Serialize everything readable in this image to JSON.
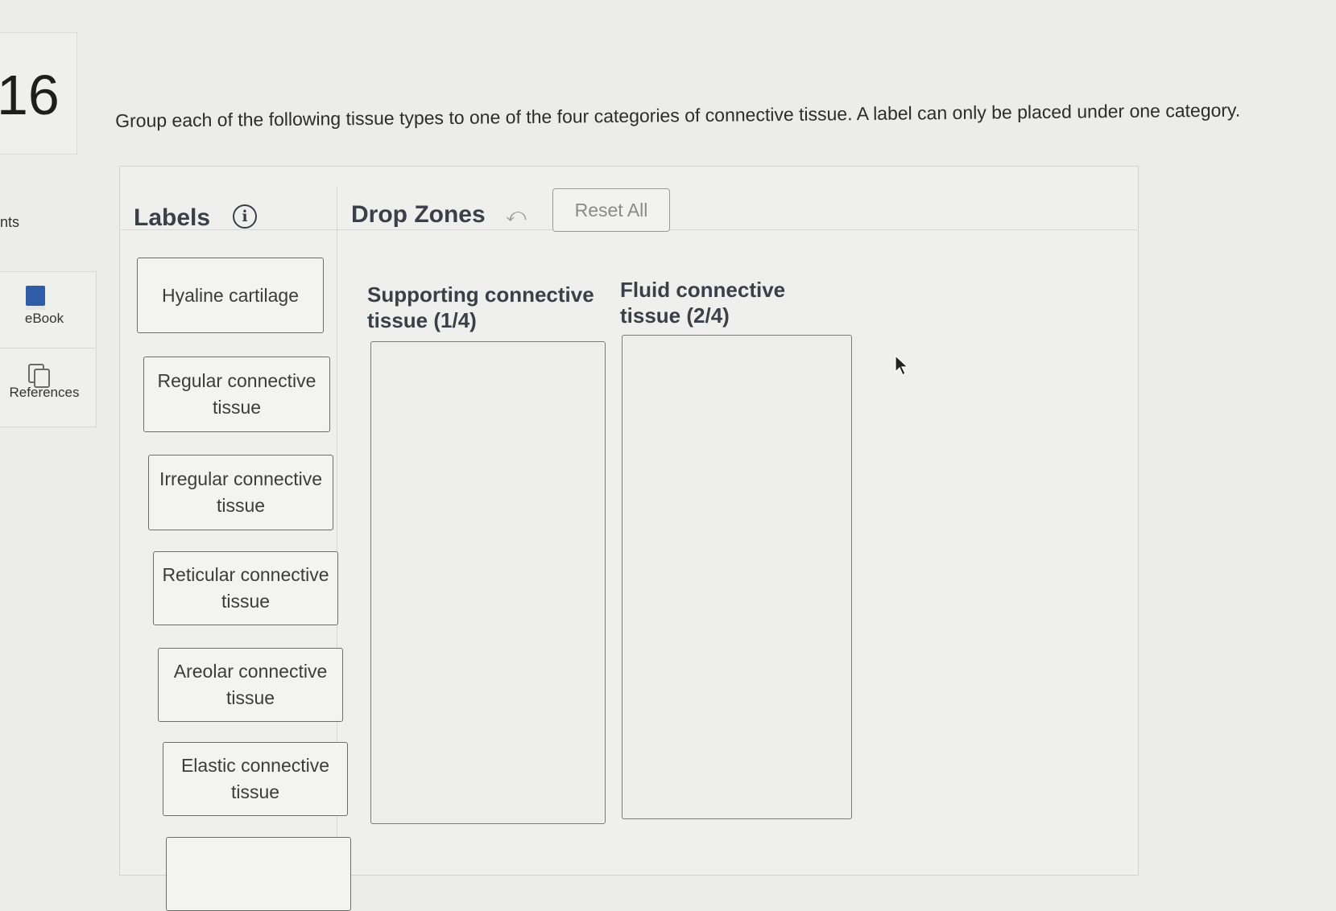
{
  "question": {
    "number": "16",
    "instructions": "Group each of the following tissue types to one of the four categories of connective tissue. A label can only be placed under one category."
  },
  "sidebar": {
    "partial_label": "nts",
    "items": [
      {
        "label": "eBook",
        "icon": "book-icon"
      },
      {
        "label": "References",
        "icon": "references-icon"
      }
    ]
  },
  "labels_panel": {
    "title": "Labels",
    "info_icon": "i",
    "items": [
      "Hyaline cartilage",
      "Regular connective tissue",
      "Irregular connective tissue",
      "Reticular connective tissue",
      "Areolar connective tissue",
      "Elastic connective tissue"
    ]
  },
  "drop_zones_panel": {
    "title": "Drop Zones",
    "undo_icon": "⤺",
    "reset_label": "Reset All",
    "zones": [
      {
        "title": "Supporting connective tissue (1/4)"
      },
      {
        "title": "Fluid connective tissue (2/4)"
      }
    ]
  },
  "colors": {
    "background": "#ececea",
    "heading": "#3a3f48",
    "ebook_icon": "#2e5ca6"
  }
}
